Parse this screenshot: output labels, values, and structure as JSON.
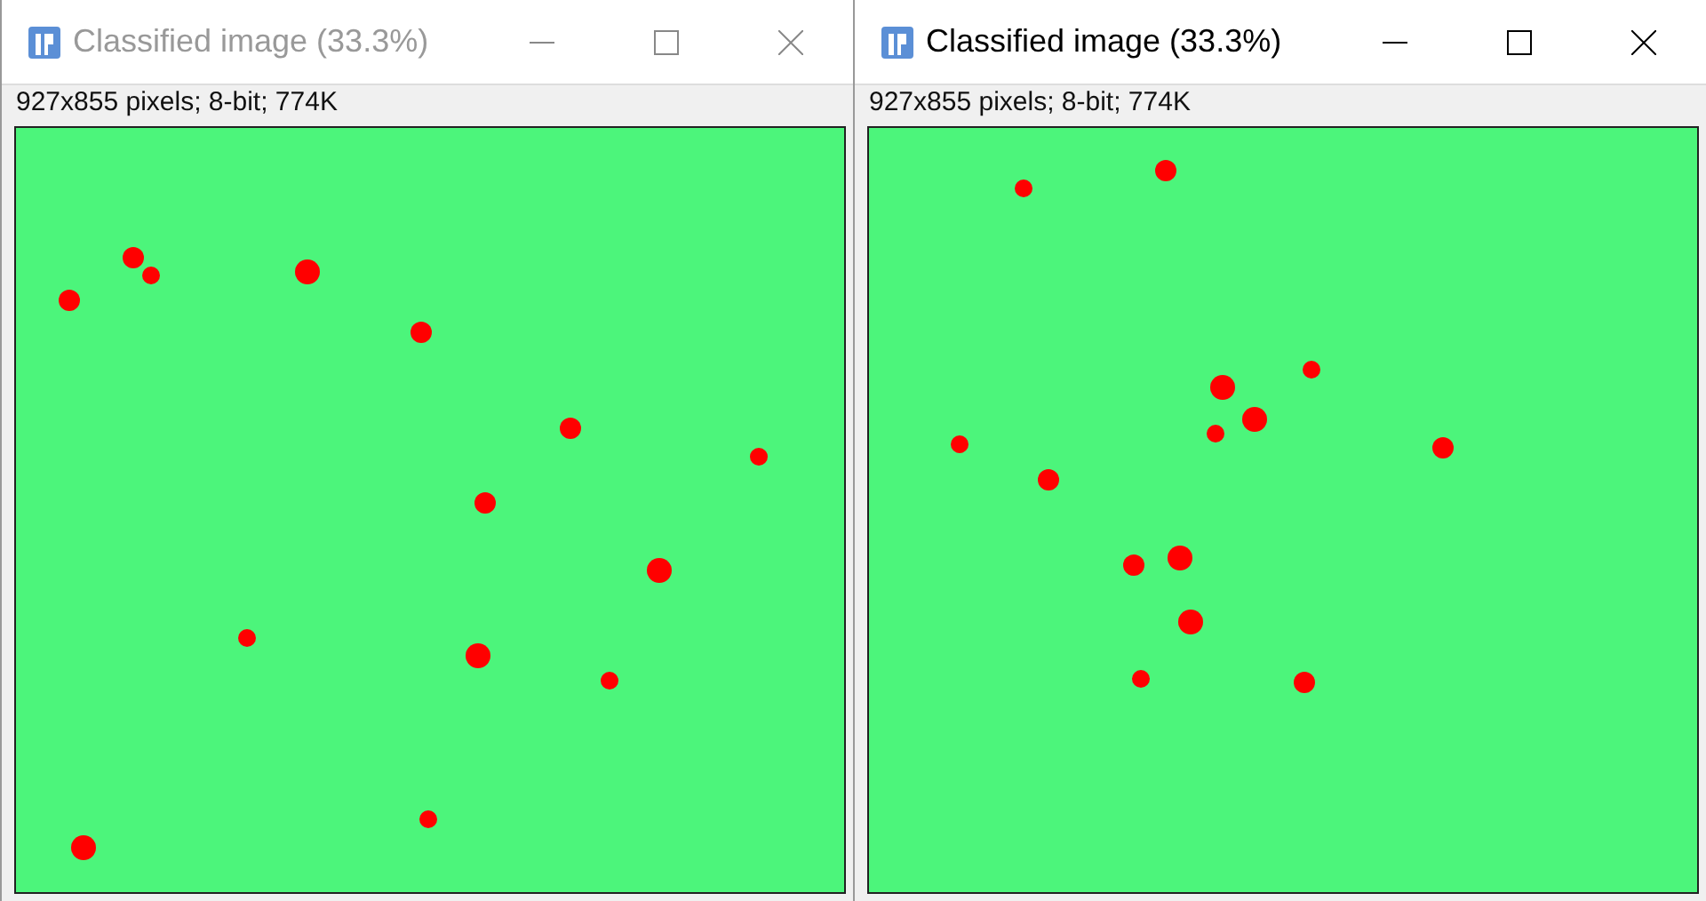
{
  "windows": [
    {
      "title": "Classified image (33.3%)",
      "active": false,
      "info": "927x855 pixels; 8-bit; 774K"
    },
    {
      "title": "Classified image (33.3%)",
      "active": true,
      "info": "927x855 pixels; 8-bit; 774K"
    }
  ]
}
